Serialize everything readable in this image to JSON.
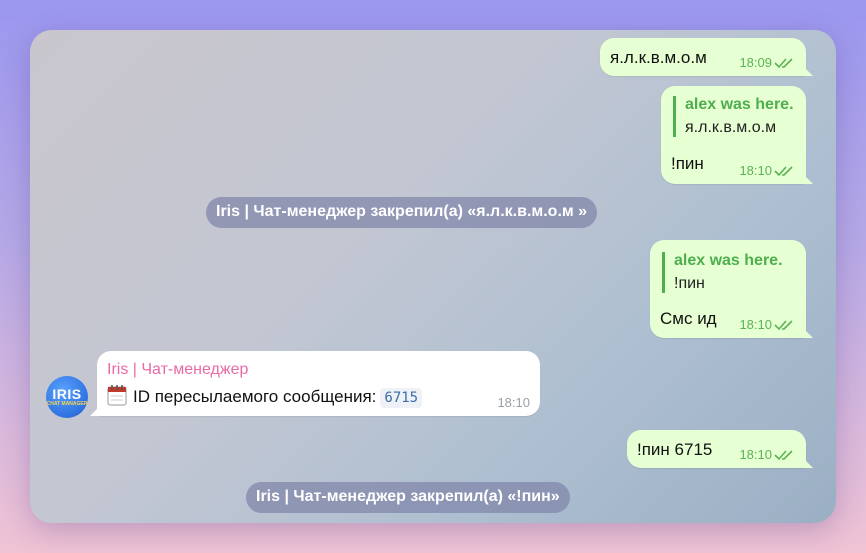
{
  "messages": {
    "m1": {
      "text": "я.л.к.в.м.о.м",
      "time": "18:09"
    },
    "m2": {
      "reply_author": "alex was here.",
      "reply_text": "я.л.к.в.м.о.м",
      "text": "!пин",
      "time": "18:10"
    },
    "m3": {
      "reply_author": "alex was here.",
      "reply_text": "!пин",
      "text": "Смс ид",
      "time": "18:10"
    },
    "m4": {
      "sender": "Iris | Чат-менеджер",
      "text": "ID пересылаемого сообщения:",
      "code": "6715",
      "time": "18:10"
    },
    "m5": {
      "text": "!пин 6715",
      "time": "18:10"
    }
  },
  "service": {
    "s1": "Iris | Чат-менеджер закрепил(а) «я.л.к.в.м.о.м »",
    "s2": "Iris | Чат-менеджер закрепил(а) «!пин»"
  },
  "avatar": {
    "main": "IRIS",
    "sub": "CHAT MANAGER"
  },
  "colors": {
    "outgoing_bubble": "#e6ffd3",
    "accent_green": "#4fae4e",
    "sender_pink": "#e86aa7"
  },
  "icons": {
    "read_status": "double-check-icon",
    "calendar": "calendar-icon"
  }
}
